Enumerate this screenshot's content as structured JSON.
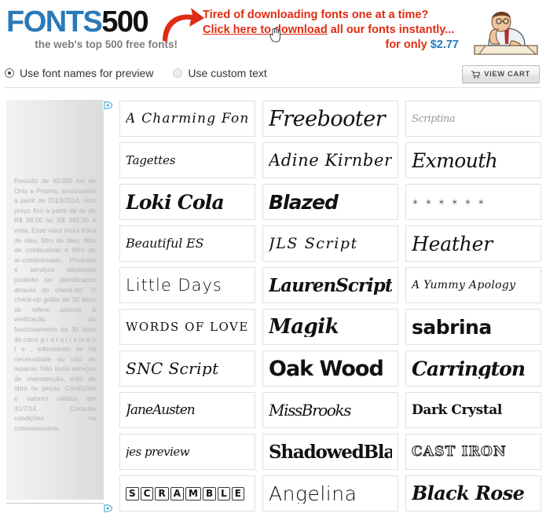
{
  "site": {
    "logo_primary": "FONTS",
    "logo_secondary": "500",
    "tagline": "the web's top 500 free fonts!"
  },
  "promo": {
    "line1": "Tired of downloading fonts one at a time?",
    "link_text": "Click here to download",
    "line2_rest": " all our fonts instantly...",
    "line3_prefix": "for only ",
    "price": "$2.77",
    "text_color": "#e02b12",
    "price_color": "#2a7ab9",
    "arrow_color": "#e02b12"
  },
  "toolbar": {
    "view_cart_label": "VIEW CART",
    "cart_icon": "shopping-cart-icon"
  },
  "options": {
    "items": [
      {
        "label": "Use font names for preview",
        "selected": true
      },
      {
        "label": "Use custom text",
        "selected": false
      }
    ]
  },
  "left_ad": {
    "body": "Revisão de 40.000 km de Onix e Prisma, ano/modelo a partir de 2013/2014, com preço fixo a partir de 4x de R$ 98,00 ou R$ 392,00 à vista. Esse valor inclui troca de óleo, filtro de óleo, filtro de combustível e filtro do ar-condicionado. Produtos e serviços adicionais poderão ser identificados através do check-list. O check-up grátis de 30 itens se refere apenas à verificação do funcionamento de 30 itens do carro g r a t u i t a m e n t e , informando se há necessidade ou não de reparos. Não inclui serviços de manutenção, mão de obra ou peças. Condições e valores válidos até 31/7/14. Consulte condições na concessionária.",
    "adchoices_icon": "adchoices-icon"
  },
  "font_grid": {
    "cells": [
      {
        "name": "A Charming Font",
        "style": "s-charming"
      },
      {
        "name": "Freebooter",
        "style": "s-freebooter"
      },
      {
        "name": "Scriptina",
        "style": "s-scriptina"
      },
      {
        "name": "Tagettes",
        "style": "s-tagettes"
      },
      {
        "name": "Adine Kirnberg",
        "style": "s-adine"
      },
      {
        "name": "Exmouth",
        "style": "s-exmouth"
      },
      {
        "name": "Loki Cola",
        "style": "s-loki"
      },
      {
        "name": "Blazed",
        "style": "s-blazed"
      },
      {
        "name": "✶ ✶ ✶ ✶ ✶ ✶",
        "style": "s-cherubs"
      },
      {
        "name": "Beautiful ES",
        "style": "s-beautiful"
      },
      {
        "name": "JLS Script",
        "style": "s-jls"
      },
      {
        "name": "Heather",
        "style": "s-heather"
      },
      {
        "name": "Little Days",
        "style": "s-little"
      },
      {
        "name": "LaurenScript",
        "style": "s-lauren"
      },
      {
        "name": "A Yummy Apology",
        "style": "s-yummy"
      },
      {
        "name": "WORDS OF LOVE",
        "style": "s-words"
      },
      {
        "name": "Magik",
        "style": "s-magik"
      },
      {
        "name": "sabrina",
        "style": "s-sabrina"
      },
      {
        "name": "SNC Script",
        "style": "s-snc"
      },
      {
        "name": "Oak Wood",
        "style": "s-oak"
      },
      {
        "name": "Carrington",
        "style": "s-carrington"
      },
      {
        "name": "JaneAusten",
        "style": "s-jane"
      },
      {
        "name": "MissBrooks",
        "style": "s-miss"
      },
      {
        "name": "Dark Crystal",
        "style": "s-dark"
      },
      {
        "name": "jes preview",
        "style": "s-jes"
      },
      {
        "name": "ShadowedBlack",
        "style": "s-shadowed"
      },
      {
        "name": "CAST IRON",
        "style": "s-cast"
      },
      {
        "name": "SCRAMBLE",
        "style": "s-scramble"
      },
      {
        "name": "Angelina",
        "style": "s-angelina"
      },
      {
        "name": "Black Rose",
        "style": "s-blackrose"
      }
    ]
  }
}
